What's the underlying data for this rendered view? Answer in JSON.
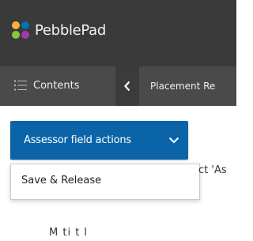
{
  "app": {
    "brand": "PebblePad"
  },
  "colors": {
    "logo": [
      "#fbb03b",
      "#0071bc",
      "#8cc63f",
      "#9e3da5"
    ],
    "topbar": "#3a3a3a",
    "navbar": "#4a4a4a",
    "accent": "#0b64a8"
  },
  "nav": {
    "contents_label": "Contents",
    "contents_icon": "list-icon",
    "back_icon": "chevron-left-icon",
    "breadcrumb": "Placement Re"
  },
  "assessor": {
    "button_label": "Assessor field actions",
    "dropdown_icon": "chevron-down-icon",
    "menu": [
      {
        "label": "Save & Release"
      }
    ]
  },
  "background": {
    "partial_text": "ct 'As",
    "bottom_text": "M ti         t l"
  }
}
